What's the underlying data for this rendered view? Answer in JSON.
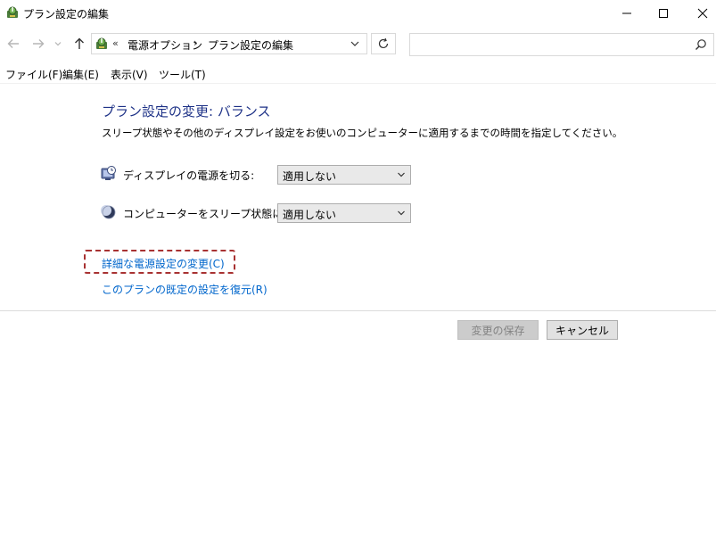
{
  "window": {
    "title": "プラン設定の編集",
    "icon": "power-options-icon"
  },
  "navigation": {
    "back_icon": "arrow-left-icon",
    "forward_icon": "arrow-right-icon",
    "recent_icon": "chevron-down-icon",
    "up_icon": "arrow-up-icon",
    "address": {
      "chevrons": "«",
      "breadcrumbs": [
        "電源オプション",
        "プラン設定の編集"
      ],
      "separator": "›"
    },
    "refresh_icon": "refresh-icon",
    "search": {
      "value": "",
      "placeholder": ""
    }
  },
  "menu": {
    "items": [
      "ファイル(F)",
      "編集(E)",
      "表示(V)",
      "ツール(T)"
    ]
  },
  "content": {
    "title": "プラン設定の変更: バランス",
    "description": "スリープ状態やその他のディスプレイ設定をお使いのコンピューターに適用するまでの時間を指定してください。",
    "settings": [
      {
        "label": "ディスプレイの電源を切る:",
        "value": "適用しない",
        "icon": "monitor-clock-icon"
      },
      {
        "label": "コンピューターをスリープ状態にする:",
        "value": "適用しない",
        "icon": "moon-icon"
      }
    ],
    "links": {
      "advanced": "詳細な電源設定の変更(C)",
      "restore": "このプランの既定の設定を復元(R)"
    }
  },
  "buttons": {
    "save": "変更の保存",
    "cancel": "キャンセル"
  },
  "colors": {
    "title_blue": "#1e3287",
    "link_blue": "#0066cc",
    "highlight_red": "#a83232"
  }
}
